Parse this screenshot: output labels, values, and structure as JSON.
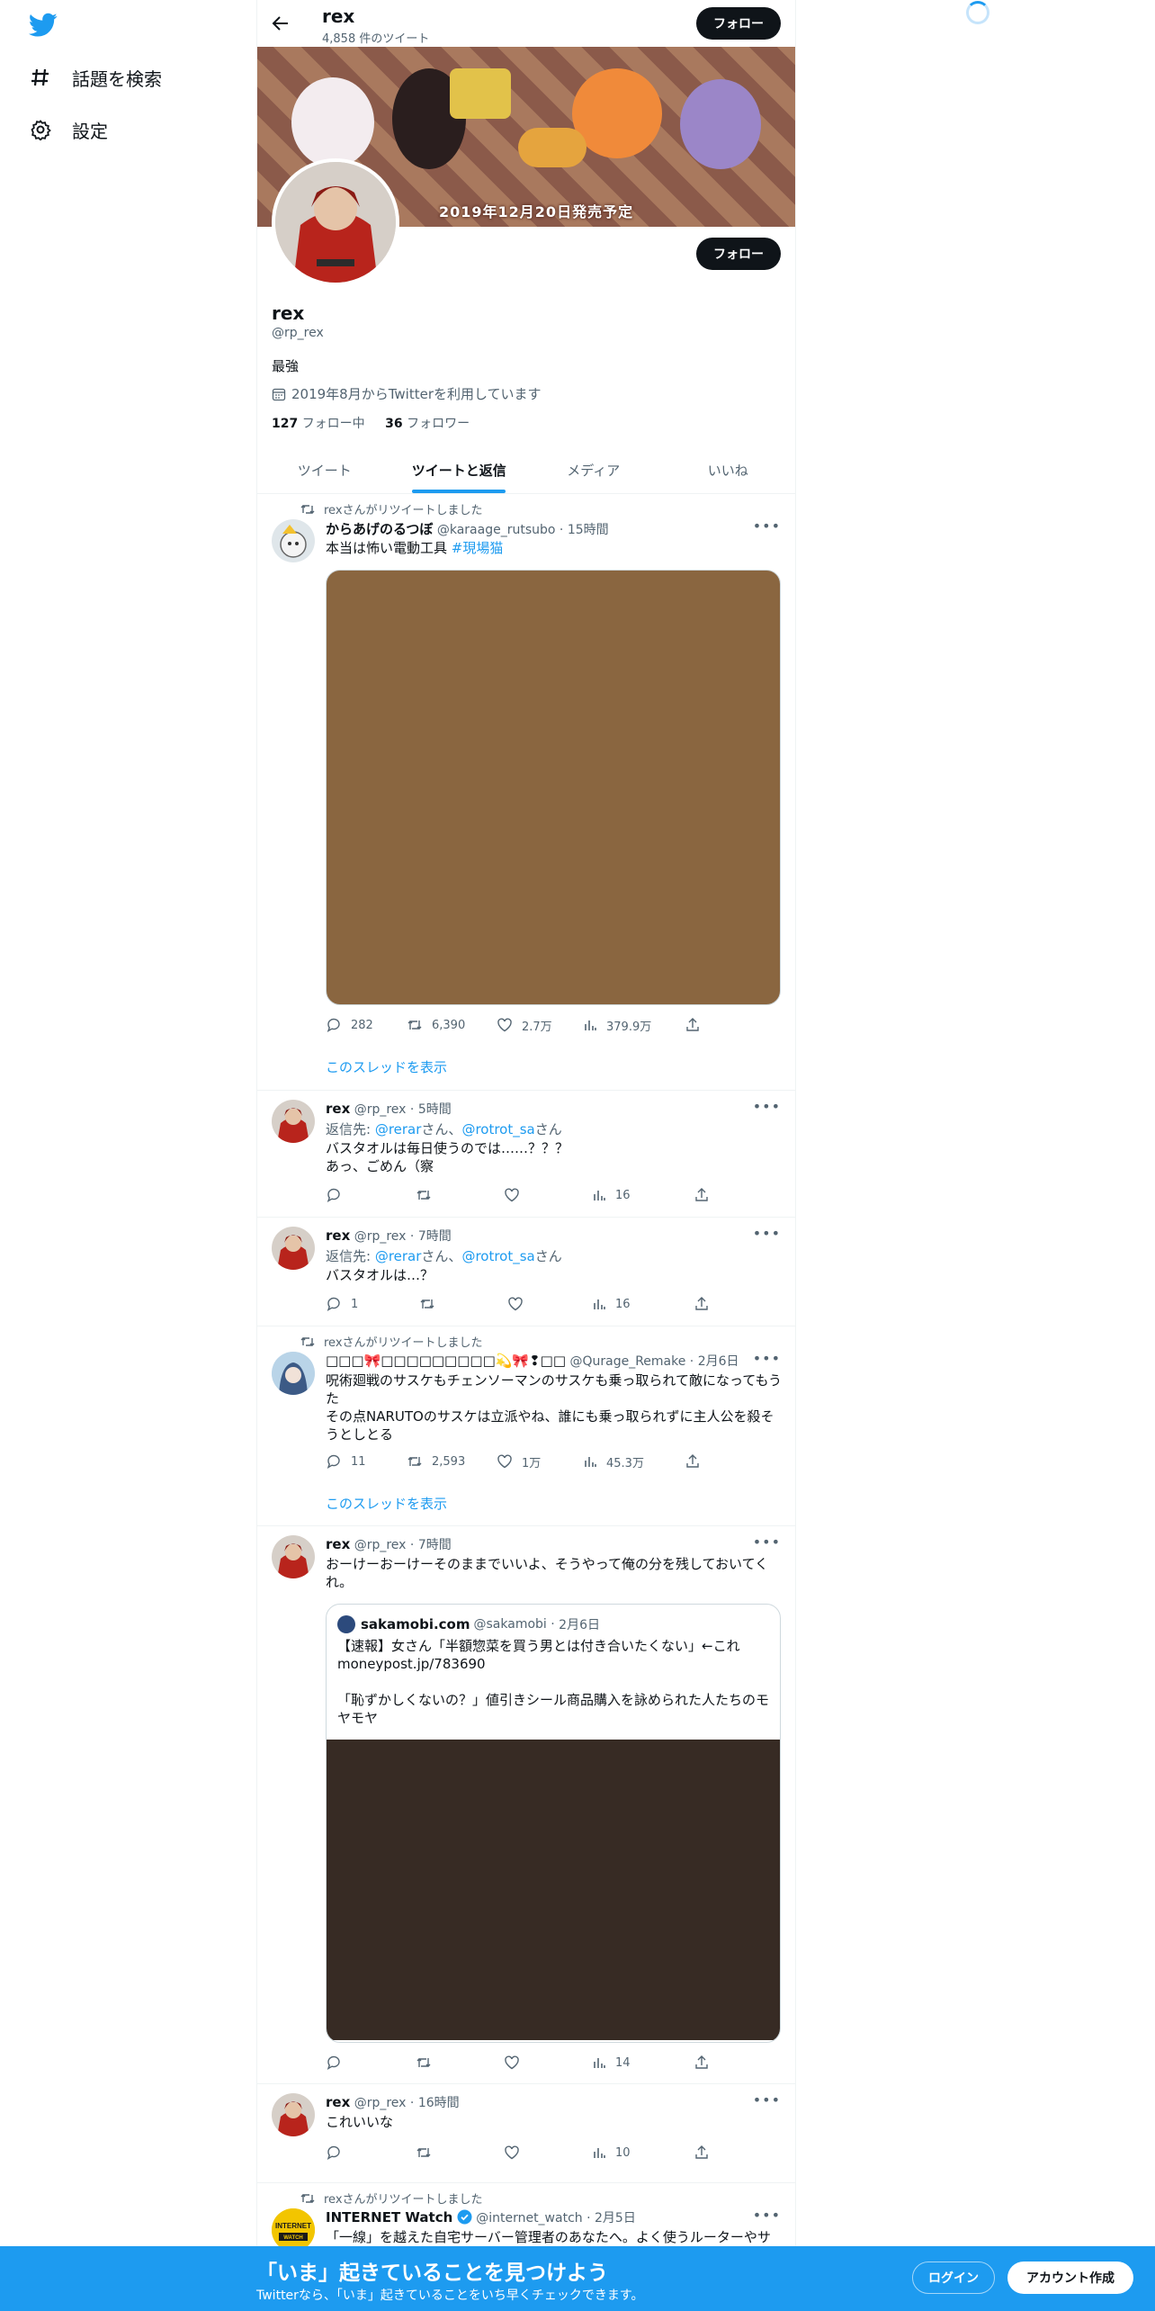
{
  "sidebar": {
    "items": [
      {
        "label": "話題を検索",
        "icon": "hashtag-icon"
      },
      {
        "label": "設定",
        "icon": "gear-icon"
      }
    ]
  },
  "header": {
    "name": "rex",
    "tweet_count": "4,858 件のツイート",
    "follow_label": "フォロー"
  },
  "banner": {
    "caption": "2019年12月20日発売予定"
  },
  "profile": {
    "name": "rex",
    "handle": "@rp_rex",
    "bio": "最強",
    "joined": "2019年8月からTwitterを利用しています",
    "following_count": "127",
    "following_label": "フォロー中",
    "followers_count": "36",
    "followers_label": "フォロワー",
    "follow_label": "フォロー"
  },
  "tabs": [
    "ツイート",
    "ツイートと返信",
    "メディア",
    "いいね"
  ],
  "active_tab": "ツイートと返信",
  "tweets": [
    {
      "retweeted_by": "rexさんがリツイートしました",
      "name": "からあげのるつぼ",
      "handle": "@karaage_rutsubo",
      "time": "15時間",
      "text": "本当は怖い電動工具 ",
      "hashtag": "#現場猫",
      "reply_count": "282",
      "retweet_count": "6,390",
      "like_count": "2.7万",
      "view_count": "379.9万",
      "media_color": "#8a6640",
      "thread_link": "このスレッドを表示"
    },
    {
      "name": "rex",
      "handle": "@rp_rex",
      "time": "5時間",
      "reply_prefix": "返信先: ",
      "reply_to_1": "@rerar",
      "reply_mid": "さん、",
      "reply_to_2": "@rotrot_sa",
      "reply_suffix": "さん",
      "text_line1": "バスタオルは毎日使うのでは……？？？",
      "text_line2": "あっ、ごめん（察",
      "view_count": "16"
    },
    {
      "name": "rex",
      "handle": "@rp_rex",
      "time": "7時間",
      "reply_prefix": "返信先: ",
      "reply_to_1": "@rerar",
      "reply_mid": "さん、",
      "reply_to_2": "@rotrot_sa",
      "reply_suffix": "さん",
      "text": "バスタオルは…？",
      "reply_count": "1",
      "view_count": "16"
    },
    {
      "retweeted_by": "rexさんがリツイートしました",
      "name": "□□□🎀□□□□□□□□□💫🎀❢□□",
      "handle": "@Qurage_Remake",
      "time": "2月6日",
      "text_line1": "呪術廻戦のサスケもチェンソーマンのサスケも乗っ取られて敵になってもうた",
      "text_line2": "その点NARUTOのサスケは立派やね、誰にも乗っ取られずに主人公を殺そうとしとる",
      "reply_count": "11",
      "retweet_count": "2,593",
      "like_count": "1万",
      "view_count": "45.3万",
      "thread_link": "このスレッドを表示"
    },
    {
      "name": "rex",
      "handle": "@rp_rex",
      "time": "7時間",
      "text": "おーけーおーけーそのままでいいよ、そうやって俺の分を残しておいてくれ。",
      "quote": {
        "name": "sakamobi.com",
        "handle": "@sakamobi",
        "time": "2月6日",
        "text_line1": "【速報】女さん「半額惣菜を買う男とは付き合いたくない」←これ",
        "text_line2": "moneypost.jp/783690",
        "text_line3": "「恥ずかしくないの？」値引きシール商品購入を詠められた人たちのモヤモヤ"
      },
      "view_count": "14"
    },
    {
      "name": "rex",
      "handle": "@rp_rex",
      "time": "16時間",
      "text": "これいいな",
      "view_count": "10"
    },
    {
      "retweeted_by": "rexさんがリツイートしました",
      "name": "INTERNET Watch",
      "handle": "@internet_watch",
      "time": "2月5日",
      "text": "「一線」を越えた自宅サーバー管理者のあなたへ。よく使うルーターやサーバーを集めたダッシュボードを「Docky」で作る【イニシャルB】"
    }
  ],
  "footer": {
    "title": "「いま」起きていることを見つけよう",
    "subtitle": "Twitterなら、「いま」起きていることをいち早くチェックできます。",
    "login_label": "ログイン",
    "signup_label": "アカウント作成"
  },
  "colors": {
    "brand": "#1d9bf0",
    "text": "#0f1419",
    "muted": "#536471"
  }
}
